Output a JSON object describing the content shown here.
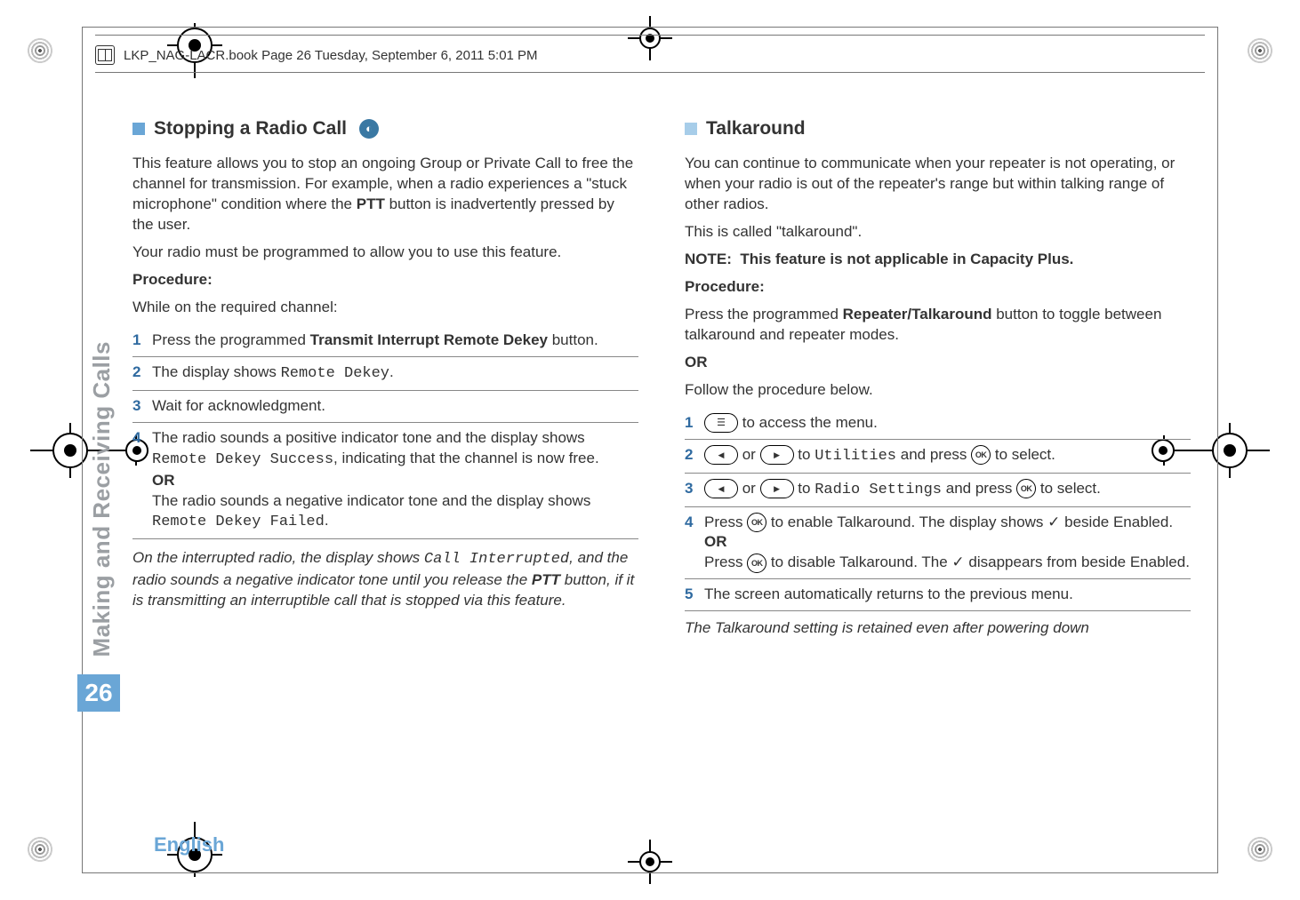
{
  "header": {
    "running_head": "LKP_NAG-LACR.book  Page 26  Tuesday, September 6, 2011  5:01 PM"
  },
  "sidetab": {
    "section_title": "Making and Receiving Calls",
    "page_number": "26"
  },
  "footer": {
    "language": "English"
  },
  "left": {
    "heading": "Stopping a Radio Call",
    "feature_icon_name": "non-display-icon",
    "intro1": "This feature allows you to stop an ongoing Group or Private Call to free the channel for transmission. For example, when a radio experiences a \"stuck microphone\" condition where the ",
    "intro1_bold": "PTT",
    "intro1_tail": " button is inadvertently pressed by the user.",
    "intro2": "Your radio must be programmed to allow you to use this feature.",
    "procedure_label": "Procedure:",
    "pre_step": "While on the required channel:",
    "steps": [
      {
        "num": "1",
        "text_a": "Press the programmed ",
        "bold": "Transmit Interrupt Remote Dekey",
        "text_b": " button."
      },
      {
        "num": "2",
        "text_a": "The display shows ",
        "mono": "Remote Dekey",
        "text_b": "."
      },
      {
        "num": "3",
        "text_a": "Wait for acknowledgment."
      },
      {
        "num": "4",
        "text_a": "The radio sounds a positive indicator tone and the display shows ",
        "mono": "Remote Dekey Success",
        "text_b": ", indicating that the channel is now free.",
        "or": "OR",
        "text_c": "The radio sounds a negative indicator tone and the display shows ",
        "mono2": "Remote Dekey Failed",
        "text_d": "."
      }
    ],
    "post_italic_a": "On the interrupted radio, the display shows ",
    "post_mono1": "Call Interrupted",
    "post_italic_b": ", and the radio sounds a negative indicator tone until you release the ",
    "post_bold": "PTT",
    "post_italic_c": " button, if it is transmitting an interruptible call that is stopped via this feature."
  },
  "right": {
    "heading": "Talkaround",
    "intro1": "You can continue to communicate when your repeater is not operating, or when your radio is out of the repeater's range but within talking range of other radios.",
    "intro2": "This is called \"talkaround\".",
    "note_label": "NOTE:",
    "note_text": "This feature is not applicable in Capacity Plus.",
    "procedure_label": "Procedure:",
    "pre_a": "Press the programmed ",
    "pre_bold": "Repeater/Talkaround",
    "pre_b": " button to toggle between talkaround and repeater modes.",
    "or": "OR",
    "pre_c": "Follow the procedure below.",
    "steps": {
      "s1_tail": " to access the menu.",
      "s2_mid": " to ",
      "s2_mono": "Utilities",
      "s2_tail": " and press ",
      "s2_end": " to select.",
      "s3_mid": " to ",
      "s3_mono": "Radio Settings",
      "s3_tail": " and press ",
      "s3_end": " to select.",
      "s4_a": "Press ",
      "s4_b": " to enable Talkaround. The display shows ",
      "s4_c": " beside Enabled.",
      "s4_or": "OR",
      "s4_d": "Press ",
      "s4_e": " to disable Talkaround. The ",
      "s4_f": " disappears from beside Enabled.",
      "s5": "The screen automatically returns to the previous menu."
    },
    "nums": {
      "n1": "1",
      "n2": "2",
      "n3": "3",
      "n4": "4",
      "n5": "5"
    },
    "post_italic": "The Talkaround setting is retained even after powering down"
  },
  "glyphs": {
    "or_word": " or ",
    "check": "✓"
  }
}
